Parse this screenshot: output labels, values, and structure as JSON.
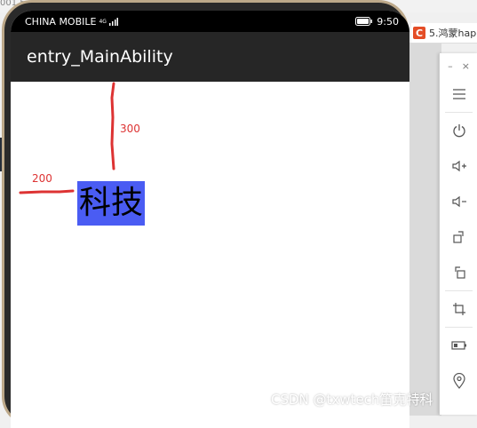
{
  "background": {
    "left_partial_text": "001.5",
    "tab_logo": "C",
    "tab_title": "5.鸿蒙hap"
  },
  "status_bar": {
    "carrier": "CHINA MOBILE",
    "network": "4G",
    "time": "9:50"
  },
  "app": {
    "title": "entry_MainAbility",
    "sample_text": "科技",
    "sample_bg_color": "#4a5cf3",
    "annotation_top_margin": "300",
    "annotation_left_margin": "200",
    "annotation_color": "#dd3333"
  },
  "toolbar": {
    "minimize": "–",
    "close": "×",
    "items": [
      "menu-icon",
      "power-icon",
      "volume-up-icon",
      "volume-down-icon",
      "rotate-icon",
      "rotate-back-icon",
      "crop-icon",
      "battery-icon",
      "location-icon"
    ]
  },
  "watermark": "CSDN @txwtech笛克特科"
}
